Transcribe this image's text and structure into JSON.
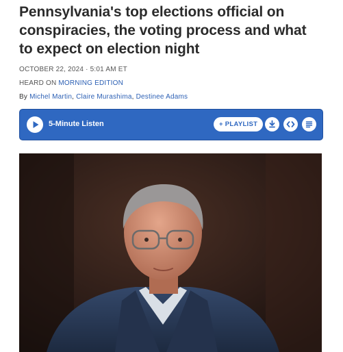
{
  "article": {
    "headline": "Pennsylvania's top elections official on conspiracies, the voting process and what to expect on election night",
    "date": "October 22, 2024 · 5:01 AM ET",
    "heard_prefix": "Heard on",
    "heard_program": "Morning Edition",
    "byline_prefix": "By",
    "authors": [
      "Michel Martin",
      "Claire Murashima",
      "Destinee Adams"
    ]
  },
  "player": {
    "listen_label": "5-Minute Listen",
    "playlist_label": "+ PLAYLIST",
    "accent_color": "#2f68c1",
    "icons": [
      "play-icon",
      "download-icon",
      "embed-icon",
      "transcript-icon"
    ]
  },
  "photo": {
    "subject": "man-portrait-photo"
  }
}
